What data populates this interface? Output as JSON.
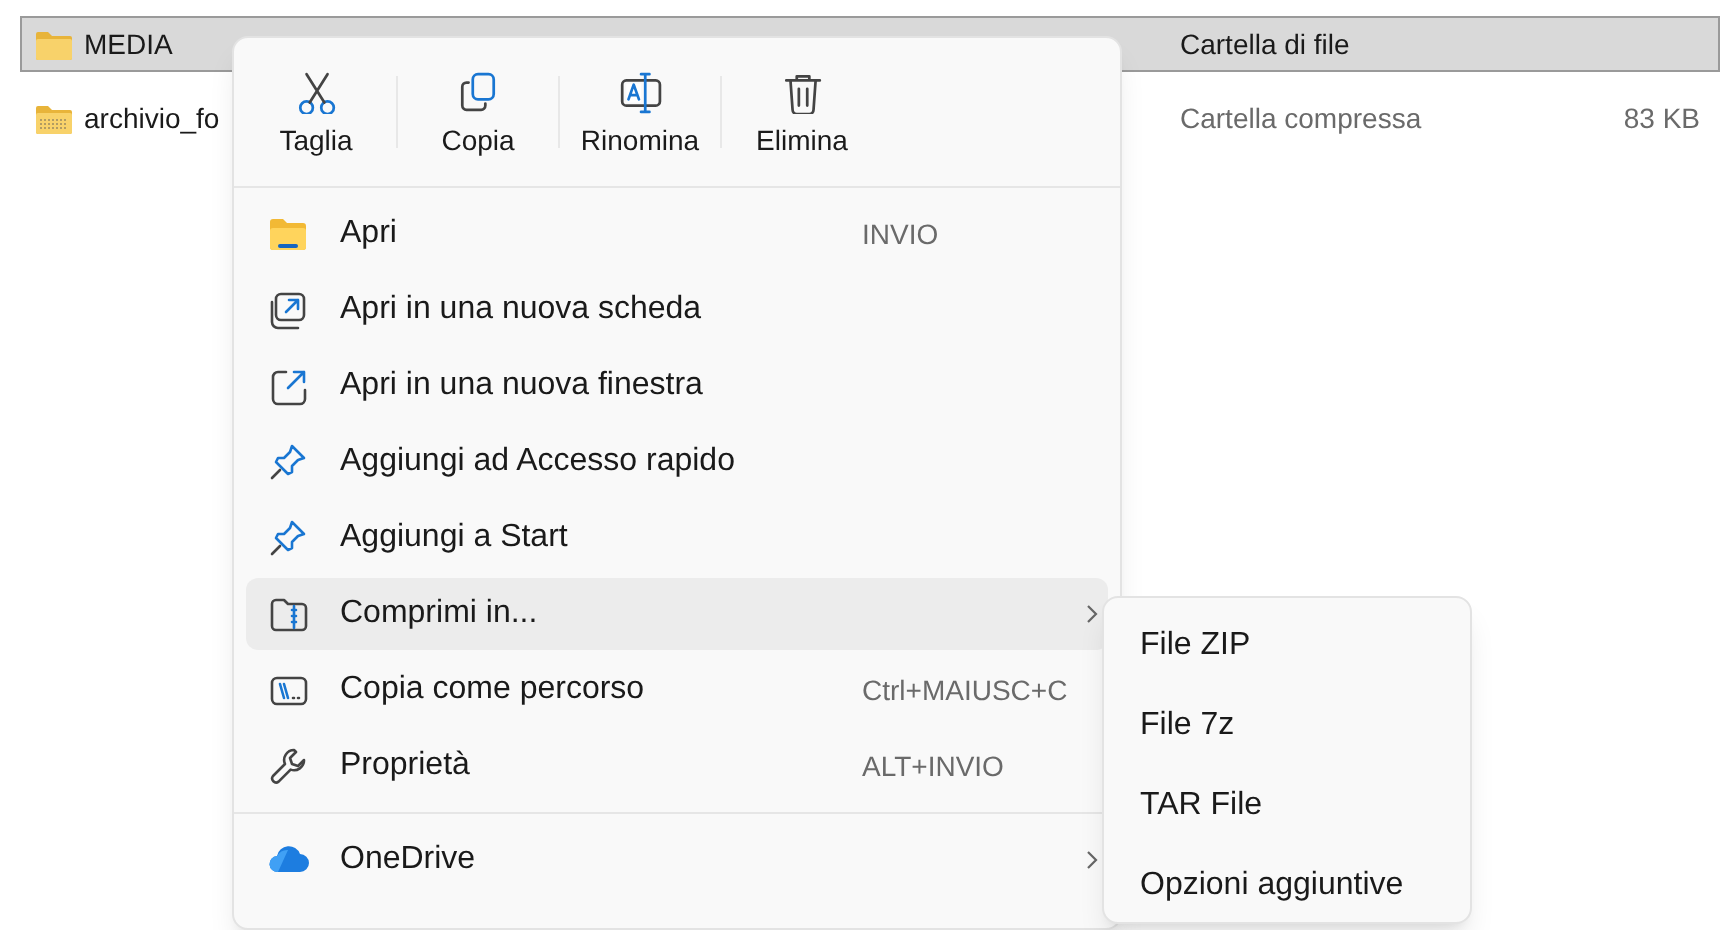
{
  "files": [
    {
      "name": "MEDIA",
      "kind": "folder",
      "type": "Cartella di file",
      "selected": true
    },
    {
      "name": "archivio_fo",
      "kind": "zip",
      "type": "Cartella compressa",
      "size": "83 KB",
      "selected": false
    }
  ],
  "context_menu": {
    "toolbar": [
      {
        "label": "Taglia"
      },
      {
        "label": "Copia"
      },
      {
        "label": "Rinomina"
      },
      {
        "label": "Elimina"
      }
    ],
    "groups": [
      [
        {
          "label": "Apri",
          "shortcut": "INVIO",
          "has_submenu": false,
          "selected": false
        },
        {
          "label": "Apri in una nuova scheda",
          "has_submenu": false,
          "selected": false
        },
        {
          "label": "Apri in una nuova finestra",
          "has_submenu": false,
          "selected": false
        },
        {
          "label": "Aggiungi ad Accesso rapido",
          "has_submenu": false,
          "selected": false
        },
        {
          "label": "Aggiungi a Start",
          "has_submenu": false,
          "selected": false
        },
        {
          "label": "Comprimi in...",
          "has_submenu": true,
          "selected": true
        },
        {
          "label": "Copia come percorso",
          "shortcut": "Ctrl+MAIUSC+C",
          "has_submenu": false,
          "selected": false
        },
        {
          "label": "Proprietà",
          "shortcut": "ALT+INVIO",
          "has_submenu": false,
          "selected": false
        }
      ],
      [
        {
          "label": "OneDrive",
          "has_submenu": true,
          "selected": false
        }
      ]
    ]
  },
  "submenu": {
    "items": [
      {
        "label": "File ZIP"
      },
      {
        "label": "File 7z"
      },
      {
        "label": "TAR File"
      },
      {
        "label": "Opzioni aggiuntive"
      }
    ]
  }
}
